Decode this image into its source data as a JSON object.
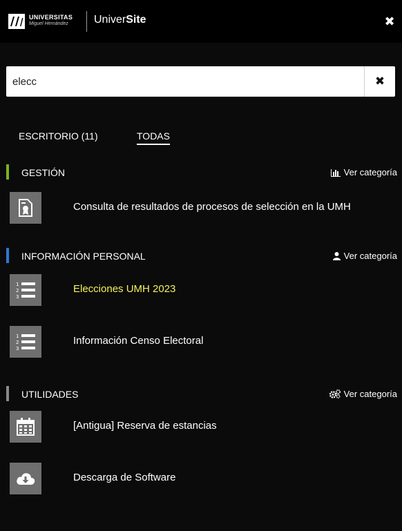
{
  "header": {
    "logo_line1": "UNIVERSITAS",
    "logo_line2": "Miguel Hernández",
    "app_title_prefix": "Univer",
    "app_title_bold": "Site",
    "close_symbol": "✖"
  },
  "search": {
    "value": "elecc",
    "placeholder": "",
    "clear_symbol": "✖"
  },
  "tabs": [
    {
      "label": "ESCRITORIO (11)",
      "active": false
    },
    {
      "label": "TODAS",
      "active": true
    }
  ],
  "categories": [
    {
      "title": "GESTIÓN",
      "link": "Ver categoría",
      "link_icon": "bar-chart-icon",
      "accent": "#7ab51d",
      "items": [
        {
          "label": "Consulta de resultados de procesos de selección en la UMH",
          "icon": "certificate-icon"
        }
      ]
    },
    {
      "title": "INFORMACIÓN PERSONAL",
      "link": "Ver categoría",
      "link_icon": "user-icon",
      "accent": "#2a7bd3",
      "items": [
        {
          "label": "Elecciones UMH 2023",
          "icon": "numbered-list-icon",
          "highlight": true
        },
        {
          "label": "Información Censo Electoral",
          "icon": "numbered-list-icon"
        }
      ]
    },
    {
      "title": "UTILIDADES",
      "link": "Ver categoría",
      "link_icon": "gears-icon",
      "accent": "#8a8a8a",
      "items": [
        {
          "label": "[Antigua] Reserva de estancias",
          "icon": "calendar-icon"
        },
        {
          "label": "Descarga de Software",
          "icon": "cloud-download-icon"
        }
      ]
    }
  ],
  "colors": {
    "background": "#0b0b0b",
    "topbar": "#000000",
    "tile": "#6e6e6e",
    "highlight_text": "#f3f25a"
  }
}
